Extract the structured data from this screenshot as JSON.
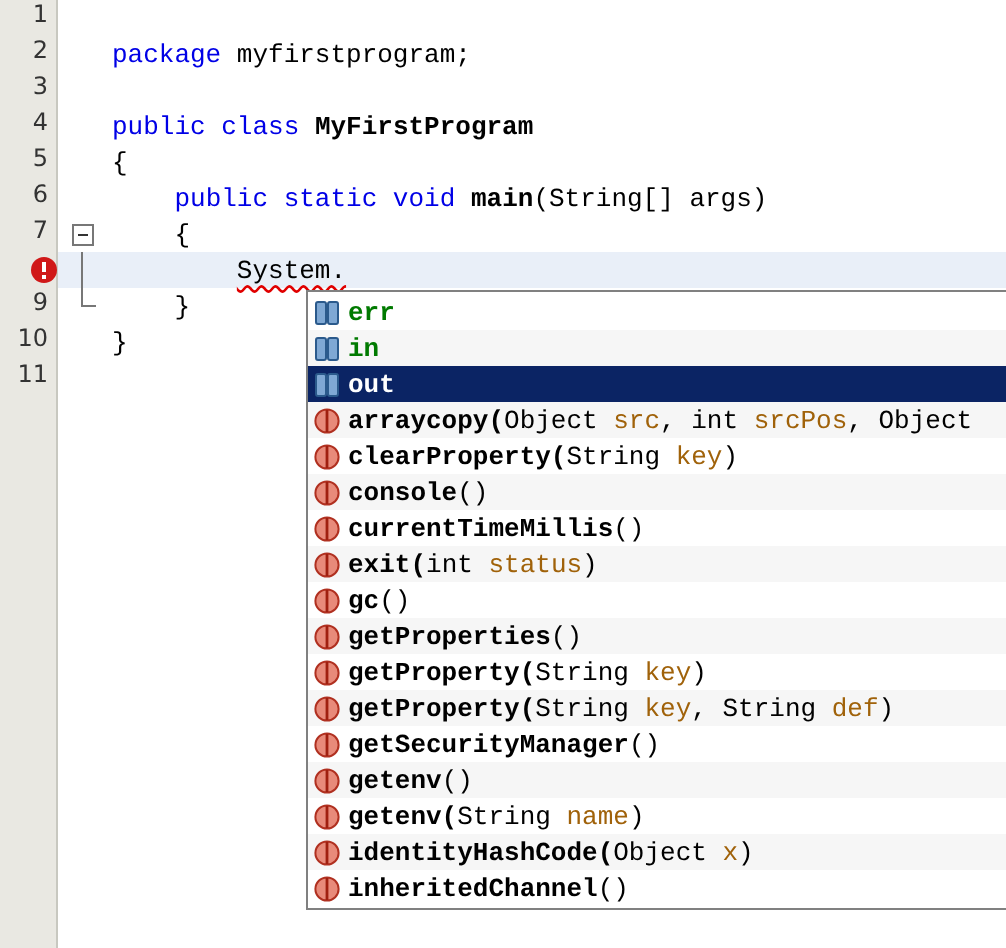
{
  "editor": {
    "lines": [
      {
        "number": "1"
      },
      {
        "number": "2",
        "tokens": [
          {
            "kind": "keyword",
            "text": "package"
          },
          {
            "kind": "plain",
            "text": " myfirstprogram;"
          }
        ]
      },
      {
        "number": "3"
      },
      {
        "number": "4",
        "tokens": [
          {
            "kind": "keyword",
            "text": "public class"
          },
          {
            "kind": "bold",
            "text": " MyFirstProgram"
          }
        ]
      },
      {
        "number": "5",
        "tokens": [
          {
            "kind": "plain",
            "text": "{"
          }
        ]
      },
      {
        "number": "6",
        "tokens": [
          {
            "kind": "keyword",
            "text": "    public static void"
          },
          {
            "kind": "bold",
            "text": " main"
          },
          {
            "kind": "plain",
            "text": "(String[] args)"
          }
        ]
      },
      {
        "number": "7",
        "expanded": true,
        "tokens": [
          {
            "kind": "plain",
            "text": "    {"
          }
        ]
      },
      {
        "fold_line": true,
        "current": true,
        "error": true,
        "tokens": [
          {
            "kind": "error",
            "text": "        System."
          }
        ]
      },
      {
        "number": "9",
        "fold_end": true,
        "tokens": [
          {
            "kind": "plain",
            "text": "    }"
          }
        ]
      },
      {
        "number": "10",
        "tokens": [
          {
            "kind": "plain",
            "text": "}"
          }
        ]
      },
      {
        "number": "11"
      }
    ]
  },
  "completion": {
    "items": [
      {
        "kind": "field",
        "selected": false,
        "parts": [
          {
            "kind": "name",
            "text": "err"
          }
        ]
      },
      {
        "kind": "field",
        "selected": false,
        "parts": [
          {
            "kind": "name",
            "text": "in"
          }
        ]
      },
      {
        "kind": "field",
        "selected": true,
        "parts": [
          {
            "kind": "name",
            "text": "out"
          }
        ]
      },
      {
        "kind": "method",
        "selected": false,
        "parts": [
          {
            "kind": "name",
            "text": "arraycopy("
          },
          {
            "kind": "type",
            "text": "Object "
          },
          {
            "kind": "param",
            "text": "src"
          },
          {
            "kind": "type",
            "text": ", int "
          },
          {
            "kind": "param",
            "text": "srcPos"
          },
          {
            "kind": "type",
            "text": ", Object"
          }
        ]
      },
      {
        "kind": "method",
        "selected": false,
        "parts": [
          {
            "kind": "name",
            "text": "clearProperty("
          },
          {
            "kind": "type",
            "text": "String "
          },
          {
            "kind": "param",
            "text": "key"
          },
          {
            "kind": "type",
            "text": ")"
          }
        ]
      },
      {
        "kind": "method",
        "selected": false,
        "parts": [
          {
            "kind": "name",
            "text": "console"
          },
          {
            "kind": "type",
            "text": "()"
          }
        ]
      },
      {
        "kind": "method",
        "selected": false,
        "parts": [
          {
            "kind": "name",
            "text": "currentTimeMillis"
          },
          {
            "kind": "type",
            "text": "()"
          }
        ]
      },
      {
        "kind": "method",
        "selected": false,
        "parts": [
          {
            "kind": "name",
            "text": "exit("
          },
          {
            "kind": "type",
            "text": "int "
          },
          {
            "kind": "param",
            "text": "status"
          },
          {
            "kind": "type",
            "text": ")"
          }
        ]
      },
      {
        "kind": "method",
        "selected": false,
        "parts": [
          {
            "kind": "name",
            "text": "gc"
          },
          {
            "kind": "type",
            "text": "()"
          }
        ]
      },
      {
        "kind": "method",
        "selected": false,
        "parts": [
          {
            "kind": "name",
            "text": "getProperties"
          },
          {
            "kind": "type",
            "text": "()"
          }
        ]
      },
      {
        "kind": "method",
        "selected": false,
        "parts": [
          {
            "kind": "name",
            "text": "getProperty("
          },
          {
            "kind": "type",
            "text": "String "
          },
          {
            "kind": "param",
            "text": "key"
          },
          {
            "kind": "type",
            "text": ")"
          }
        ]
      },
      {
        "kind": "method",
        "selected": false,
        "parts": [
          {
            "kind": "name",
            "text": "getProperty("
          },
          {
            "kind": "type",
            "text": "String "
          },
          {
            "kind": "param",
            "text": "key"
          },
          {
            "kind": "type",
            "text": ", String "
          },
          {
            "kind": "param",
            "text": "def"
          },
          {
            "kind": "type",
            "text": ")"
          }
        ]
      },
      {
        "kind": "method",
        "selected": false,
        "parts": [
          {
            "kind": "name",
            "text": "getSecurityManager"
          },
          {
            "kind": "type",
            "text": "()"
          }
        ]
      },
      {
        "kind": "method",
        "selected": false,
        "parts": [
          {
            "kind": "name",
            "text": "getenv"
          },
          {
            "kind": "type",
            "text": "()"
          }
        ]
      },
      {
        "kind": "method",
        "selected": false,
        "parts": [
          {
            "kind": "name",
            "text": "getenv("
          },
          {
            "kind": "type",
            "text": "String "
          },
          {
            "kind": "param",
            "text": "name"
          },
          {
            "kind": "type",
            "text": ")"
          }
        ]
      },
      {
        "kind": "method",
        "selected": false,
        "parts": [
          {
            "kind": "name",
            "text": "identityHashCode("
          },
          {
            "kind": "type",
            "text": "Object "
          },
          {
            "kind": "param",
            "text": "x"
          },
          {
            "kind": "type",
            "text": ")"
          }
        ]
      },
      {
        "kind": "method",
        "selected": false,
        "parts": [
          {
            "kind": "name",
            "text": "inheritedChannel"
          },
          {
            "kind": "type",
            "text": "()"
          }
        ]
      }
    ]
  }
}
